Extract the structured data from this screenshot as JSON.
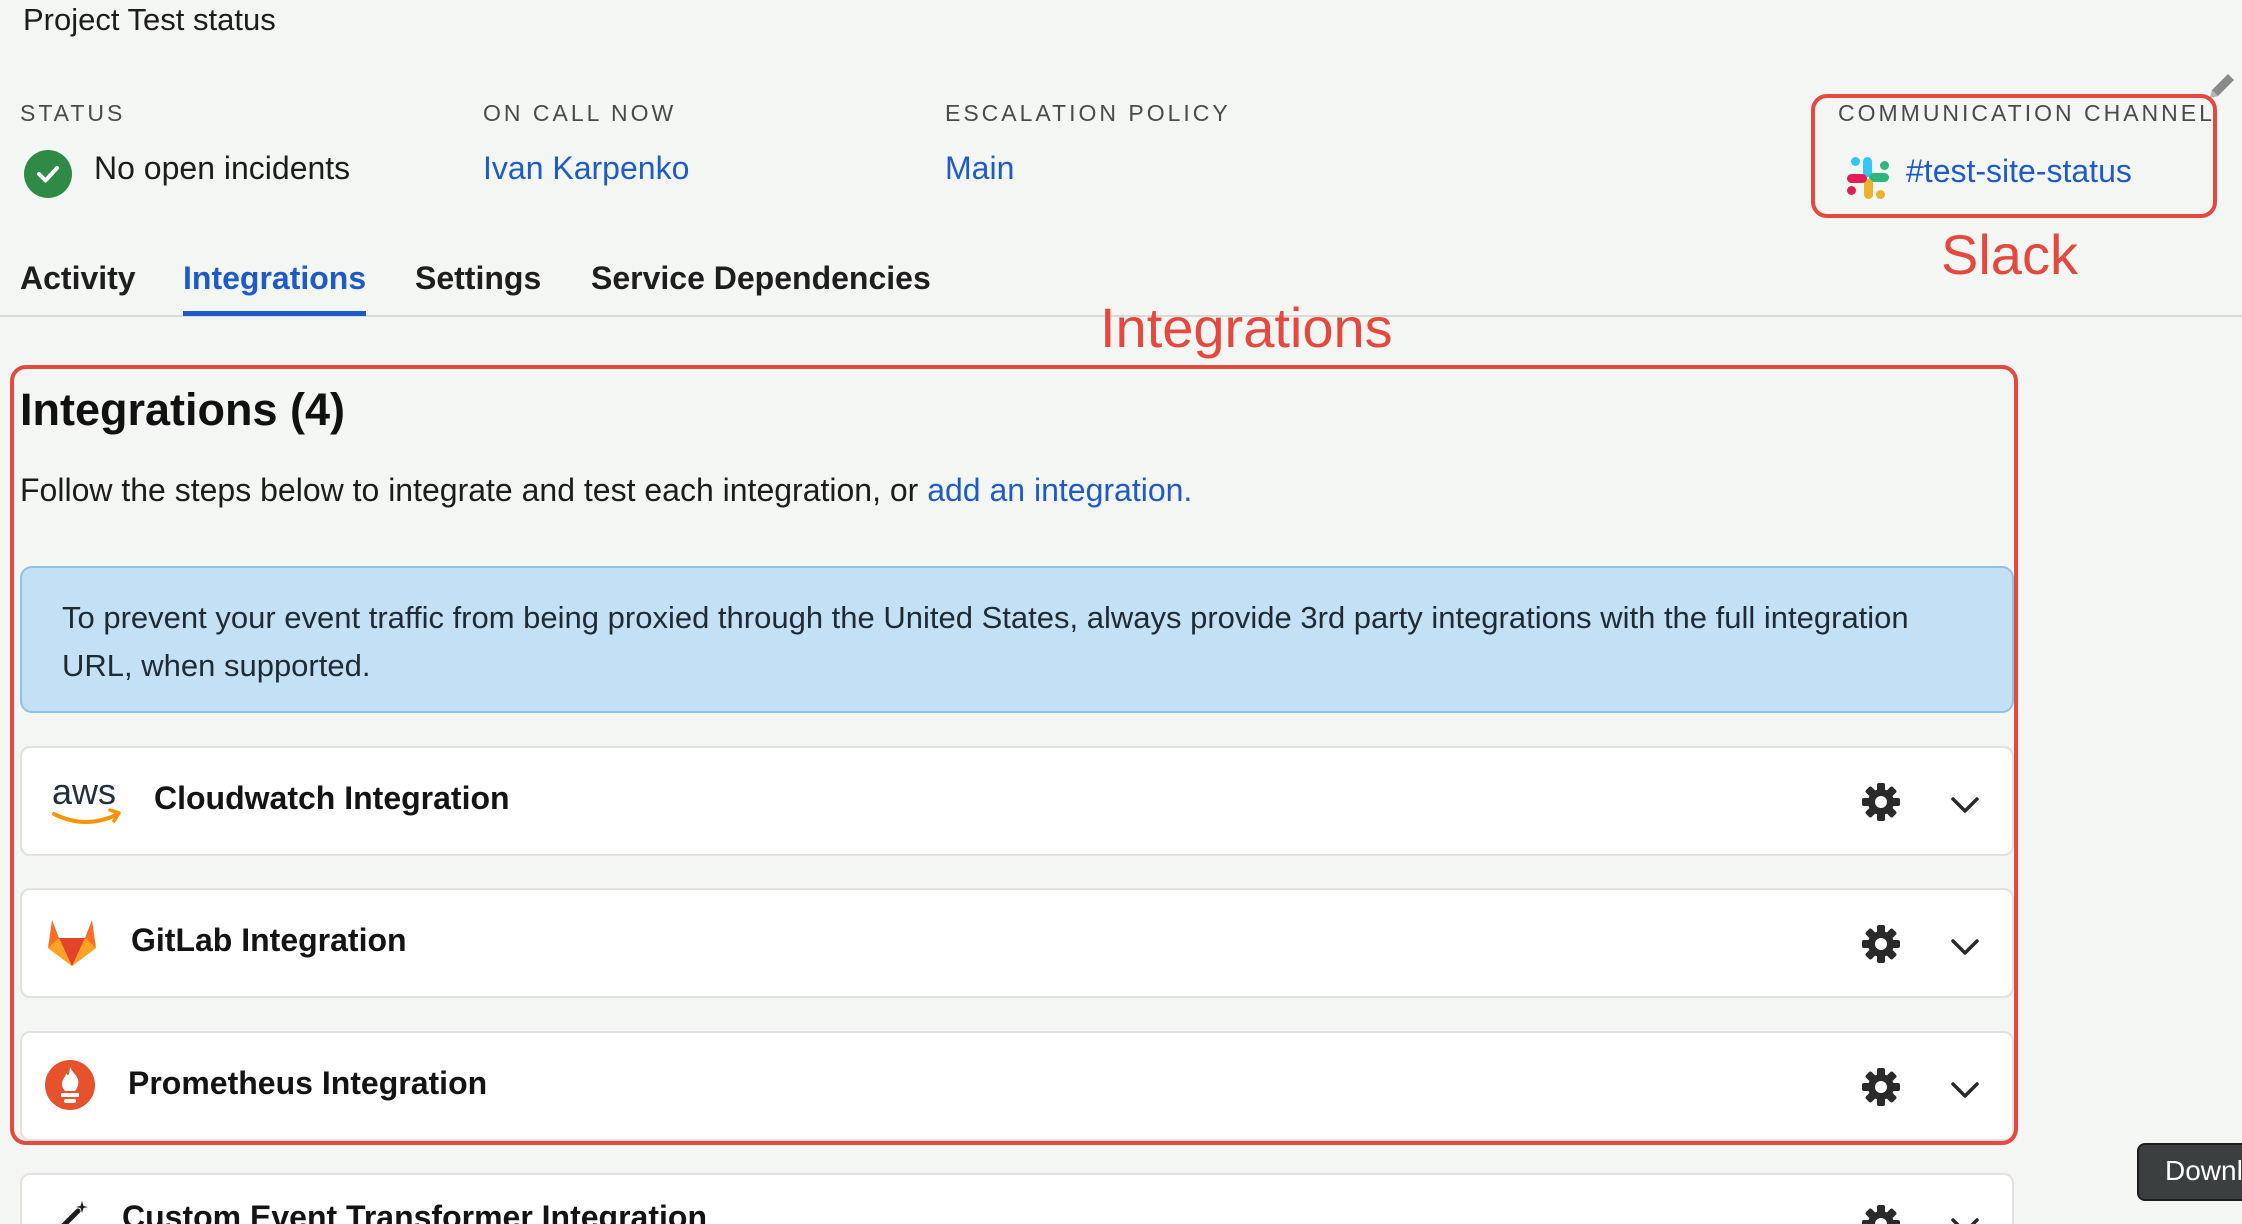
{
  "header": {
    "service_title": "Project Test status"
  },
  "summary": {
    "status_label": "STATUS",
    "status_text": "No open incidents",
    "oncall_label": "ON CALL NOW",
    "oncall_name": "Ivan Karpenko",
    "escalation_label": "ESCALATION POLICY",
    "escalation_value": "Main",
    "comm_label": "COMMUNICATION CHANNEL",
    "comm_channel": "#test-site-status"
  },
  "tabs": [
    {
      "label": "Activity",
      "active": false
    },
    {
      "label": "Integrations",
      "active": true
    },
    {
      "label": "Settings",
      "active": false
    },
    {
      "label": "Service Dependencies",
      "active": false
    }
  ],
  "integrations": {
    "heading": "Integrations (4)",
    "description": "Follow the steps below to integrate and test each integration, or ",
    "add_link": "add an integration.",
    "banner": "To prevent your event traffic from being proxied through the United States, always provide 3rd party integrations with the full integration URL, when supported.",
    "items": [
      {
        "name": "Cloudwatch Integration",
        "icon": "aws-logo-icon"
      },
      {
        "name": "GitLab Integration",
        "icon": "gitlab-logo-icon"
      },
      {
        "name": "Prometheus Integration",
        "icon": "prometheus-logo-icon"
      },
      {
        "name": "Custom Event Transformer Integration",
        "icon": "magic-wand-icon"
      }
    ]
  },
  "annotations": {
    "slack": "Slack",
    "integrations": "Integrations",
    "annotation_color": "#e3493f"
  },
  "aws_logo_text": "aws",
  "download_button": "Downl",
  "colors": {
    "link": "#1f5bc6",
    "status_ok": "#2f8a45",
    "banner_bg": "#c4e0f5"
  }
}
